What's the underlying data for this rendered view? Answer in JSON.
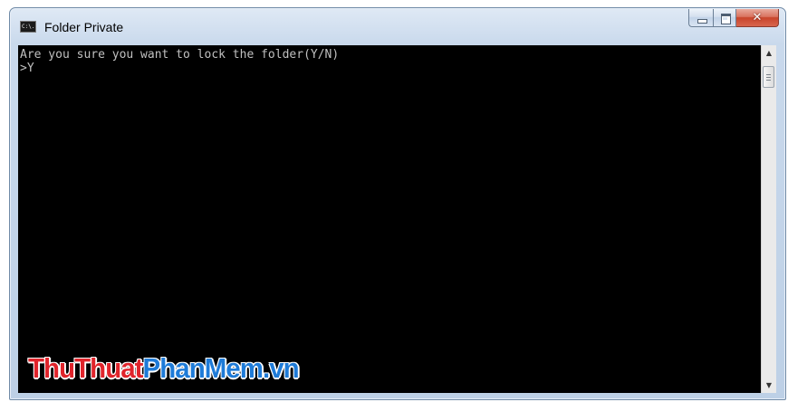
{
  "window": {
    "title": "Folder Private",
    "icon": "cmd-console-icon",
    "icon_text": "C:\\.",
    "buttons": {
      "minimize": "minimize-icon",
      "maximize": "maximize-icon",
      "close": "close-icon"
    }
  },
  "console": {
    "lines": [
      "Are you sure you want to lock the folder(Y/N)",
      ">Y"
    ],
    "background_color": "#000000",
    "text_color": "#c0c0c0"
  },
  "scrollbar": {
    "up_arrow": "▲",
    "down_arrow": "▼"
  },
  "watermark": {
    "part1": "ThuThuat",
    "part2": "PhanMem.vn",
    "color1": "#e0242b",
    "color2": "#1e7bd8"
  }
}
